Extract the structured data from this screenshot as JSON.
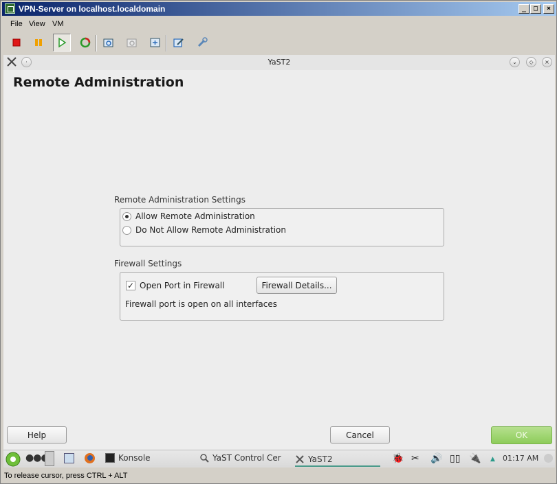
{
  "window": {
    "title": "VPN-Server on localhost.localdomain"
  },
  "menu": [
    {
      "label": "File"
    },
    {
      "label": "View"
    },
    {
      "label": "VM"
    }
  ],
  "toolbar": {
    "icons": [
      "stop-icon",
      "pause-icon",
      "play-icon",
      "reset-icon",
      "snapshot-icon",
      "revert-snapshot-icon",
      "snapshot-manager-icon",
      "edit-settings-icon",
      "tools-icon"
    ]
  },
  "kde_window": {
    "title": "YaST2"
  },
  "page": {
    "title": "Remote Administration",
    "remote_group": {
      "label": "Remote Administration Settings",
      "options": [
        {
          "label": "Allow Remote Administration",
          "selected": true
        },
        {
          "label": "Do Not Allow Remote Administration",
          "selected": false
        }
      ]
    },
    "firewall_group": {
      "label": "Firewall Settings",
      "checkbox": {
        "label": "Open Port in Firewall",
        "checked": true,
        "mark": "✓"
      },
      "details_button": "Firewall Details...",
      "status": "Firewall port is open on all interfaces"
    }
  },
  "buttons": {
    "help": "Help",
    "cancel": "Cancel",
    "ok": "OK"
  },
  "taskbar": {
    "items": [
      {
        "label": "Konsole"
      },
      {
        "label": "YaST Control Cer"
      },
      {
        "label": "YaST2"
      }
    ],
    "clock": "01:17 AM"
  },
  "status_bar": "To release cursor, press CTRL + ALT",
  "colors": {
    "titlebar_start": "#0a246a",
    "titlebar_end": "#a6caf0",
    "ok_button": "#8dcc5a"
  }
}
